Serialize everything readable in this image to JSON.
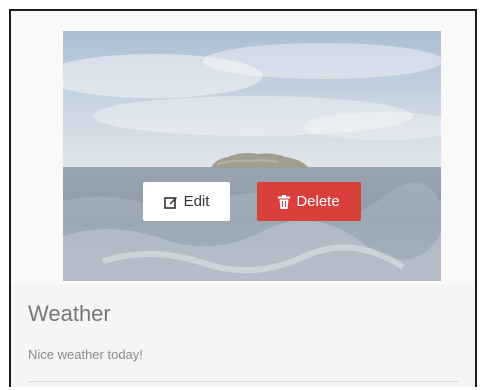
{
  "card": {
    "title": "Weather",
    "description": "Nice weather today!",
    "image_subject": "sea with island",
    "actions": {
      "edit_label": "Edit",
      "edit_icon": "edit-icon",
      "delete_label": "Delete",
      "delete_icon": "trash-icon"
    }
  },
  "colors": {
    "delete_button": "#d9403b",
    "edit_button": "#ffffff",
    "title_text": "#777777",
    "card_background": "#f5f5f5"
  }
}
